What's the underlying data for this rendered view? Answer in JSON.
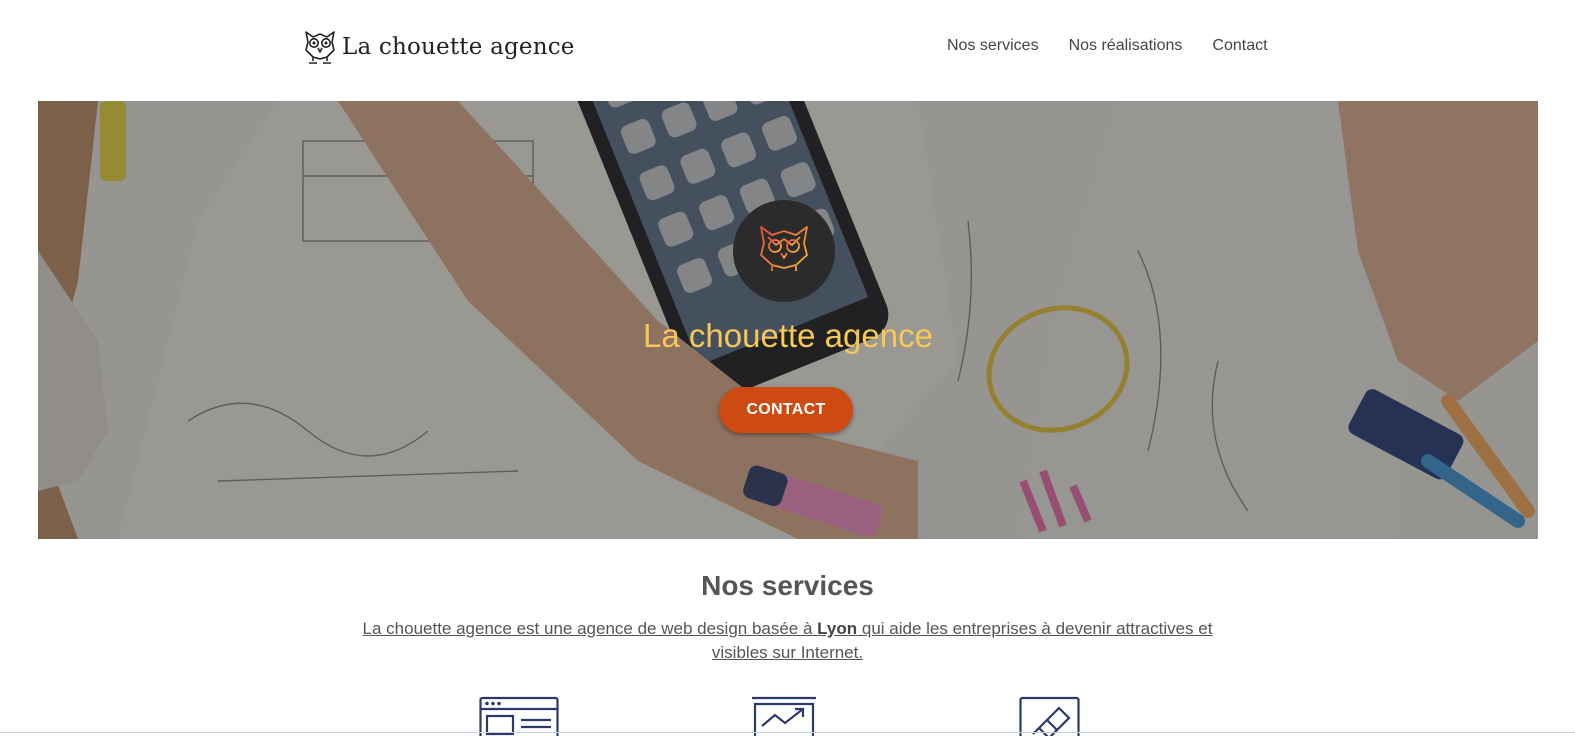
{
  "header": {
    "logo_text": "La chouette agence",
    "nav": [
      {
        "label": "Nos services"
      },
      {
        "label": "Nos réalisations"
      },
      {
        "label": "Contact"
      }
    ]
  },
  "hero": {
    "title": "La chouette agence",
    "button_label": "CONTACT"
  },
  "services": {
    "title": "Nos services",
    "desc_part1": "La chouette agence est une agence de web design basée à ",
    "desc_bold": "Lyon",
    "desc_part2": " qui aide les entreprises à devenir attractives et visibles sur Internet.",
    "icons": [
      "webpage-layout-icon",
      "chart-trend-icon",
      "pencil-edit-icon"
    ]
  },
  "colors": {
    "accent_button": "#cd4a12",
    "hero_title": "#f8c857",
    "icon_navy": "#2c3a6b"
  }
}
